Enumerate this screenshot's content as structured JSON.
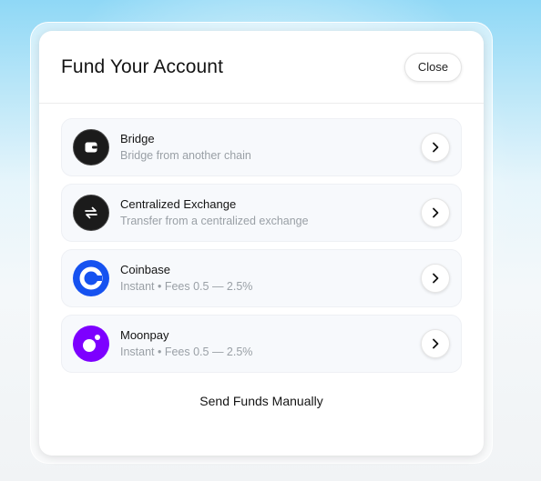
{
  "modal": {
    "title": "Fund Your Account",
    "close_label": "Close"
  },
  "options": [
    {
      "name": "bridge",
      "title": "Bridge",
      "subtitle": "Bridge from another chain",
      "icon": "wallet-icon"
    },
    {
      "name": "centralized-exchange",
      "title": "Centralized Exchange",
      "subtitle": "Transfer from a centralized exchange",
      "icon": "exchange-arrows-icon"
    },
    {
      "name": "coinbase",
      "title": "Coinbase",
      "subtitle": "Instant • Fees 0.5 — 2.5%",
      "icon": "coinbase-logo-icon",
      "color": "#1652f0"
    },
    {
      "name": "moonpay",
      "title": "Moonpay",
      "subtitle": "Instant • Fees 0.5 — 2.5%",
      "icon": "moonpay-logo-icon",
      "color": "#7d00ff"
    }
  ],
  "footer": {
    "manual_label": "Send Funds Manually"
  },
  "icons": {
    "option_arrow": "chevron-right-icon"
  }
}
